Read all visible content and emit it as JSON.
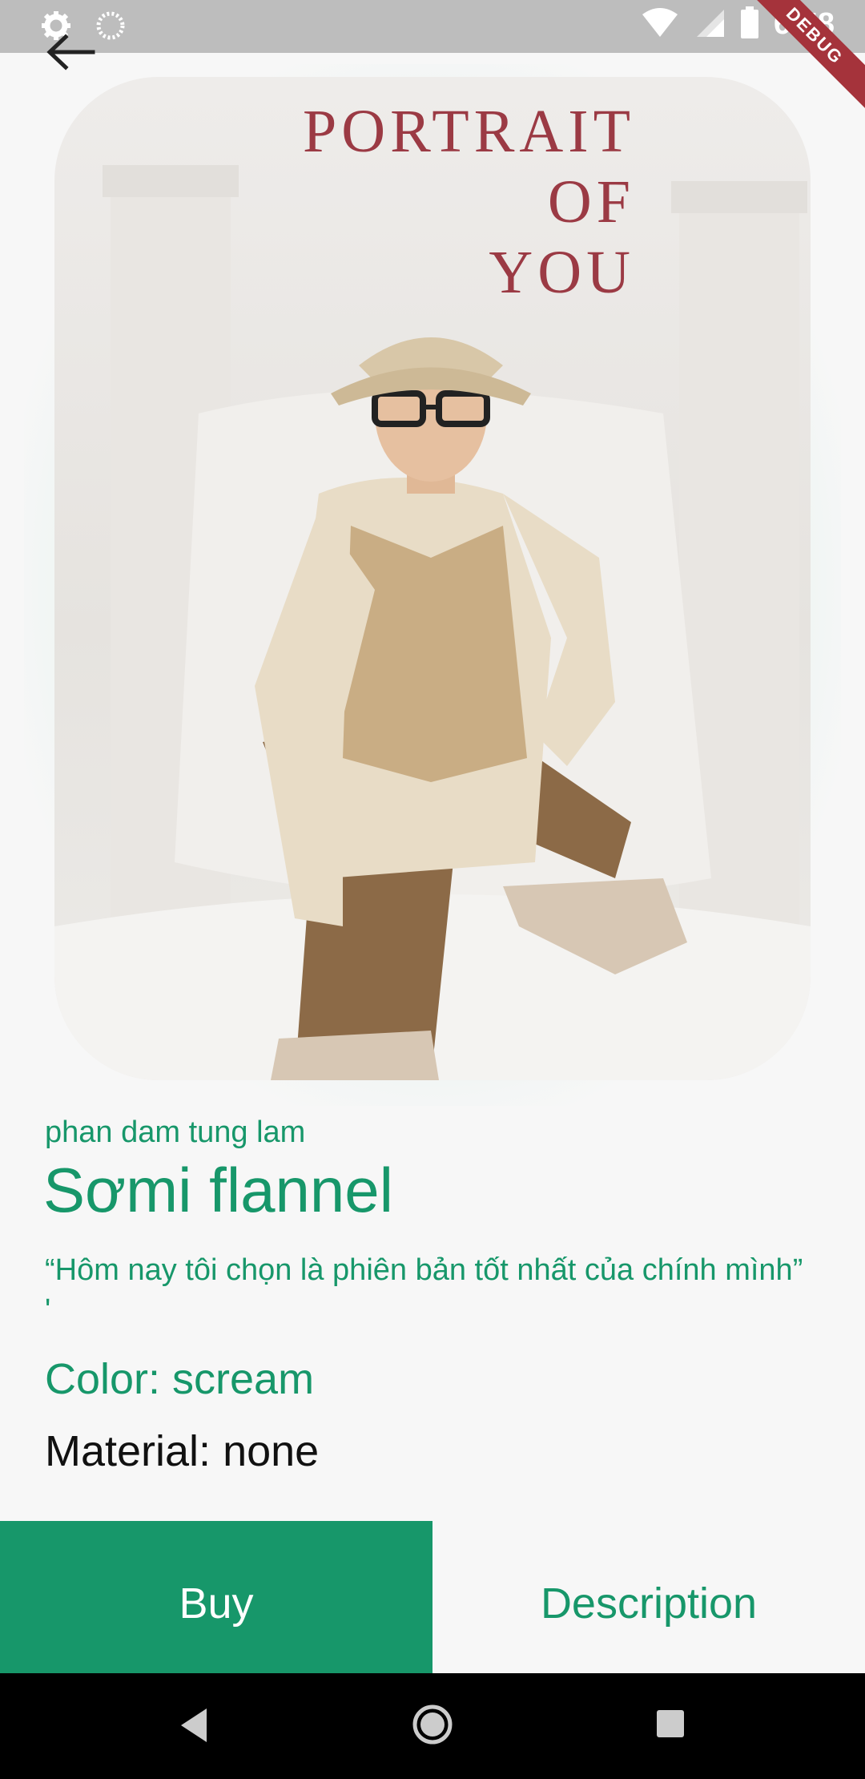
{
  "status_bar": {
    "time": "6:58",
    "debug_label": "DEBUG",
    "icons": [
      "settings-icon",
      "loading-icon",
      "wifi-icon",
      "signal-icon",
      "battery-icon"
    ]
  },
  "hero": {
    "title_lines": [
      "PORTRAIT",
      "OF",
      "YOU"
    ],
    "image": "person-in-bucket-hat-portrait"
  },
  "product": {
    "designer": "phan dam tung lam",
    "name": "Sơmi flannel",
    "quote": "“Hôm nay tôi chọn là phiên bản tốt nhất của chính mình” '",
    "color": "Color: scream",
    "material": "Material: none"
  },
  "actions": {
    "buy_label": "Buy",
    "description_label": "Description"
  },
  "colors": {
    "accent": "#17976a",
    "title_red": "#9b3a44",
    "debug_banner": "#a5333b"
  }
}
